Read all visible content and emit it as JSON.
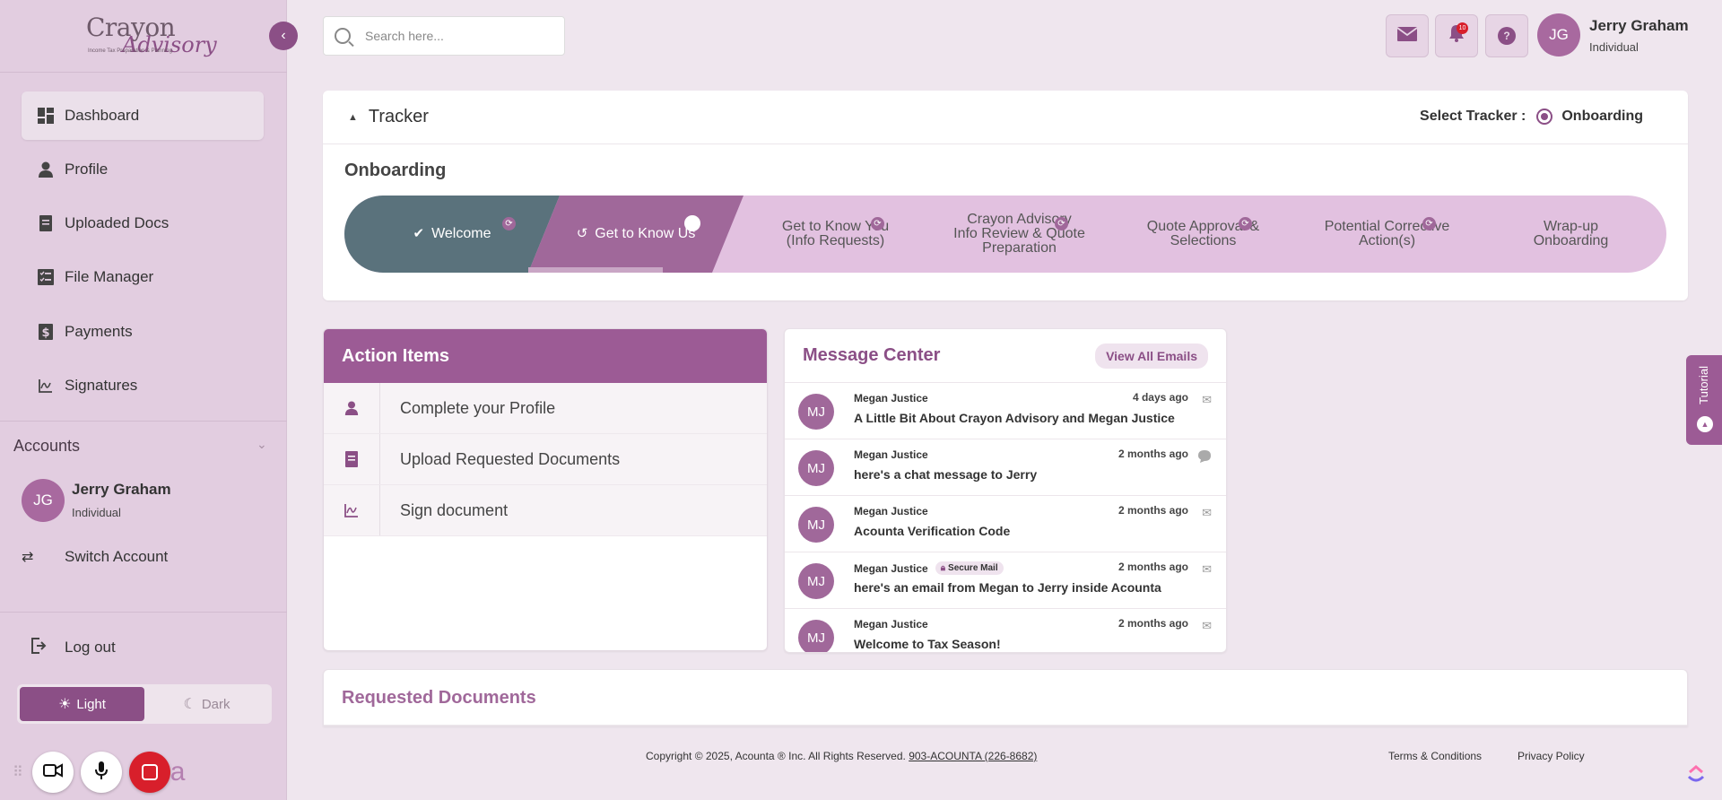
{
  "logo": {
    "main": "Crayon",
    "script": "Advisory",
    "tagline": "Income Tax Preparation & Planning"
  },
  "sidebar": {
    "items": [
      {
        "label": "Dashboard",
        "icon": "dashboard-icon"
      },
      {
        "label": "Profile",
        "icon": "person-icon"
      },
      {
        "label": "Uploaded Docs",
        "icon": "document-icon"
      },
      {
        "label": "File Manager",
        "icon": "checklist-icon"
      },
      {
        "label": "Payments",
        "icon": "dollar-icon"
      },
      {
        "label": "Signatures",
        "icon": "signature-icon"
      }
    ],
    "accounts_title": "Accounts",
    "account": {
      "initials": "JG",
      "name": "Jerry Graham",
      "role": "Individual"
    },
    "switch_label": "Switch Account",
    "logout_label": "Log out",
    "theme": {
      "light": "Light",
      "dark": "Dark",
      "selected": "Light"
    },
    "rec_trail": "a"
  },
  "header": {
    "search_placeholder": "Search here...",
    "notifications_count": "10",
    "help_glyph": "?",
    "user": {
      "initials": "JG",
      "name": "Jerry Graham",
      "role": "Individual"
    }
  },
  "tracker": {
    "title": "Tracker",
    "select_label": "Select Tracker :",
    "selected": "Onboarding",
    "section_title": "Onboarding",
    "steps": [
      {
        "line1": "Welcome",
        "line2": "",
        "line3": "",
        "state": "done"
      },
      {
        "line1": "Get to Know Us",
        "line2": "",
        "line3": "",
        "state": "current"
      },
      {
        "line1": "Get to Know You",
        "line2": "(Info Requests)",
        "line3": "",
        "state": "pending"
      },
      {
        "line1": "Crayon Advisory",
        "line2": "Info Review & Quote",
        "line3": "Preparation",
        "state": "pending"
      },
      {
        "line1": "Quote Approval &",
        "line2": "Selections",
        "line3": "",
        "state": "pending"
      },
      {
        "line1": "Potential Corrective",
        "line2": "Action(s)",
        "line3": "",
        "state": "pending"
      },
      {
        "line1": "Wrap-up",
        "line2": "Onboarding",
        "line3": "",
        "state": "pending"
      }
    ]
  },
  "action_items": {
    "title": "Action Items",
    "items": [
      {
        "label": "Complete your Profile"
      },
      {
        "label": "Upload Requested Documents"
      },
      {
        "label": "Sign document"
      }
    ]
  },
  "message_center": {
    "title": "Message Center",
    "view_all": "View All Emails",
    "secure_label": "Secure Mail",
    "messages": [
      {
        "initials": "MJ",
        "sender": "Megan Justice",
        "subject": "A Little Bit About Crayon Advisory and Megan Justice",
        "time": "4 days ago",
        "type": "mail",
        "secure": false
      },
      {
        "initials": "MJ",
        "sender": "Megan Justice",
        "subject": "here's a chat message to Jerry",
        "time": "2 months ago",
        "type": "chat",
        "secure": false
      },
      {
        "initials": "MJ",
        "sender": "Megan Justice",
        "subject": "Acounta Verification Code",
        "time": "2 months ago",
        "type": "mail",
        "secure": false
      },
      {
        "initials": "MJ",
        "sender": "Megan Justice",
        "subject": "here's an email from Megan to Jerry inside Acounta",
        "time": "2 months ago",
        "type": "mail",
        "secure": true
      },
      {
        "initials": "MJ",
        "sender": "Megan Justice",
        "subject": "Welcome to Tax Season!",
        "time": "2 months ago",
        "type": "mail",
        "secure": false
      }
    ]
  },
  "tutorial_label": "Tutorial",
  "requested_documents": {
    "title": "Requested Documents"
  },
  "footer": {
    "copyright": "Copyright © 2025, Acounta ® Inc. All Rights Reserved.",
    "phone": "903-ACOUNTA (226-8682)",
    "terms": "Terms & Conditions",
    "privacy": "Privacy Policy"
  },
  "colors": {
    "accent": "#8b4f86",
    "done_step": "#5a727c",
    "current_step": "#a0689a",
    "sidebar_bg": "#e2cde0",
    "record_red": "#d81f2b"
  }
}
